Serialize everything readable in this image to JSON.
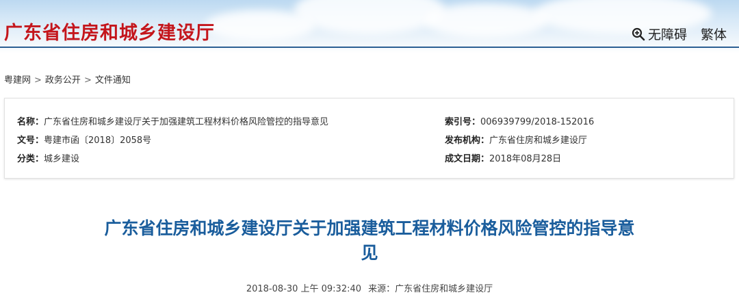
{
  "header": {
    "site_title": "广东省住房和城乡建设厅",
    "accessibility_label": "无障碍",
    "traditional_label": "繁体"
  },
  "breadcrumb": {
    "items": [
      "粤建网",
      "政务公开",
      "文件通知"
    ],
    "separator": ">"
  },
  "meta": {
    "name_label": "名称：",
    "name_value": "广东省住房和城乡建设厅关于加强建筑工程材料价格风险管控的指导意见",
    "doc_no_label": "文号：",
    "doc_no_value": "粤建市函〔2018〕2058号",
    "category_label": "分类：",
    "category_value": "城乡建设",
    "index_label": "索引号：",
    "index_value": "006939799/2018-152016",
    "publisher_label": "发布机构：",
    "publisher_value": "广东省住房和城乡建设厅",
    "date_label": "成文日期：",
    "date_value": "2018年08月28日"
  },
  "article": {
    "title_line1": "广东省住房和城乡建设厅关于加强建筑工程材料价格风险管控的指导意",
    "title_line2": "见",
    "datetime": "2018-08-30 上午 09:32:40",
    "source_label": "来源：",
    "source_value": "广东省住房和城乡建设厅"
  },
  "colors": {
    "site_title": "#c4161c",
    "article_title": "#1a5d9c",
    "header_line": "#2b5f93"
  }
}
